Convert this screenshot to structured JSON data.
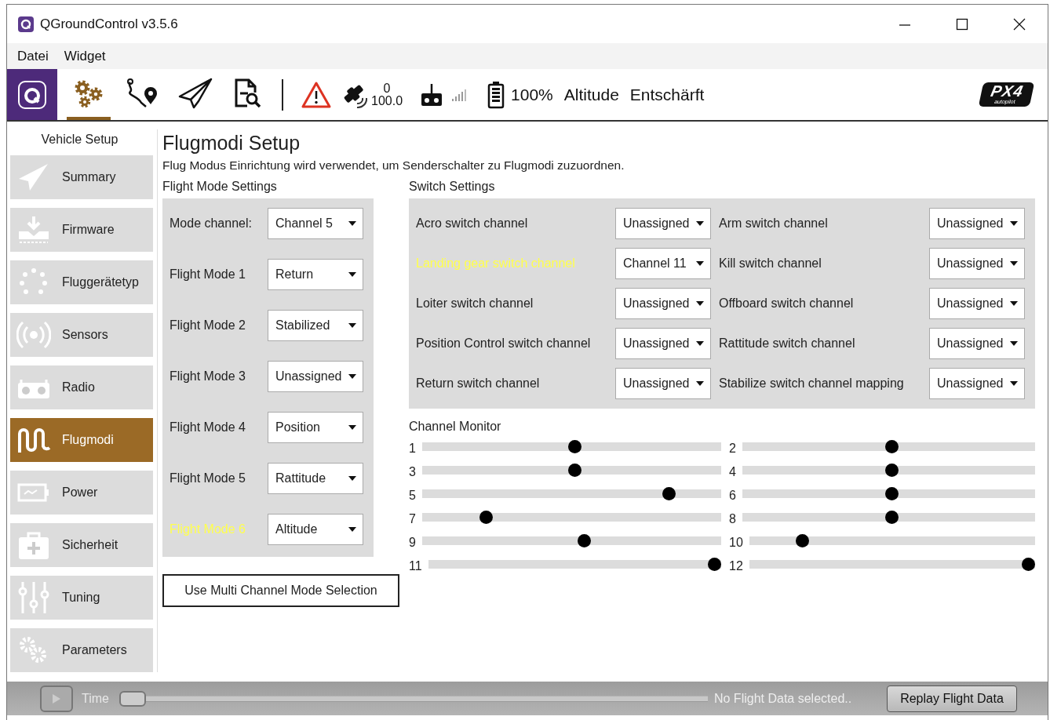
{
  "window": {
    "title": "QGroundControl v3.5.6"
  },
  "menu": [
    "Datei",
    "Widget"
  ],
  "toolbar": {
    "tools": [
      {
        "kind": "setup",
        "selected": true
      },
      {
        "kind": "plan",
        "selected": false
      },
      {
        "kind": "fly",
        "selected": false
      },
      {
        "kind": "analyze",
        "selected": false
      }
    ],
    "gps": {
      "count": "0",
      "hdop": "100.0"
    },
    "battery": "100%",
    "flight_mode": "Altitude",
    "arm_state": "Entschärft",
    "logo": {
      "text": "PX4",
      "subtext": "autopilot"
    }
  },
  "sidebar": {
    "header": "Vehicle Setup",
    "items": [
      {
        "label": "Summary",
        "kind": "summary",
        "selected": false
      },
      {
        "label": "Firmware",
        "kind": "firmware",
        "selected": false
      },
      {
        "label": "Fluggerätetyp",
        "kind": "airframe",
        "selected": false
      },
      {
        "label": "Sensors",
        "kind": "sensors",
        "selected": false
      },
      {
        "label": "Radio",
        "kind": "radio",
        "selected": false
      },
      {
        "label": "Flugmodi",
        "kind": "flightmodes",
        "selected": true
      },
      {
        "label": "Power",
        "kind": "power",
        "selected": false
      },
      {
        "label": "Sicherheit",
        "kind": "safety",
        "selected": false
      },
      {
        "label": "Tuning",
        "kind": "tuning",
        "selected": false
      },
      {
        "label": "Parameters",
        "kind": "parameters",
        "selected": false
      }
    ]
  },
  "page": {
    "title": "Flugmodi Setup",
    "description": "Flug Modus Einrichtung wird verwendet, um Senderschalter zu Flugmodi zuzuordnen.",
    "flight_mode_settings": {
      "heading": "Flight Mode Settings",
      "mode_channel": {
        "label": "Mode channel:",
        "value": "Channel 5"
      },
      "modes": [
        {
          "label": "Flight Mode 1",
          "value": "Return",
          "highlighted": false
        },
        {
          "label": "Flight Mode 2",
          "value": "Stabilized",
          "highlighted": false
        },
        {
          "label": "Flight Mode 3",
          "value": "Unassigned",
          "highlighted": false
        },
        {
          "label": "Flight Mode 4",
          "value": "Position",
          "highlighted": false
        },
        {
          "label": "Flight Mode 5",
          "value": "Rattitude",
          "highlighted": false
        },
        {
          "label": "Flight Mode 6",
          "value": "Altitude",
          "highlighted": true
        }
      ]
    },
    "switch_settings": {
      "heading": "Switch Settings",
      "switches": [
        {
          "label": "Acro switch channel",
          "value": "Unassigned",
          "highlighted": false
        },
        {
          "label": "Arm switch channel",
          "value": "Unassigned",
          "highlighted": false
        },
        {
          "label": "Landing gear switch channel",
          "value": "Channel 11",
          "highlighted": true
        },
        {
          "label": "Kill switch channel",
          "value": "Unassigned",
          "highlighted": false
        },
        {
          "label": "Loiter switch channel",
          "value": "Unassigned",
          "highlighted": false
        },
        {
          "label": "Offboard switch channel",
          "value": "Unassigned",
          "highlighted": false
        },
        {
          "label": "Position Control switch channel",
          "value": "Unassigned",
          "highlighted": false
        },
        {
          "label": "Rattitude switch channel",
          "value": "Unassigned",
          "highlighted": false
        },
        {
          "label": "Return switch channel",
          "value": "Unassigned",
          "highlighted": false
        },
        {
          "label": "Stabilize switch channel mapping",
          "value": "Unassigned",
          "highlighted": false
        }
      ]
    },
    "channel_monitor": {
      "heading": "Channel Monitor",
      "channels": [
        {
          "number": "1",
          "level": 0.51
        },
        {
          "number": "2",
          "level": 0.51
        },
        {
          "number": "3",
          "level": 0.51
        },
        {
          "number": "4",
          "level": 0.51
        },
        {
          "number": "5",
          "level": 0.84
        },
        {
          "number": "6",
          "level": 0.51
        },
        {
          "number": "7",
          "level": 0.2
        },
        {
          "number": "8",
          "level": 0.51
        },
        {
          "number": "9",
          "level": 0.545
        },
        {
          "number": "10",
          "level": 0.17
        },
        {
          "number": "11",
          "level": 1
        },
        {
          "number": "12",
          "level": 1
        }
      ]
    },
    "multi_channel_button": "Use Multi Channel Mode Selection"
  },
  "bottom_bar": {
    "time_label": "Time",
    "time_slider": {
      "level": 0
    },
    "status": "No Flight Data selected..",
    "replay_button": "Replay Flight Data"
  }
}
